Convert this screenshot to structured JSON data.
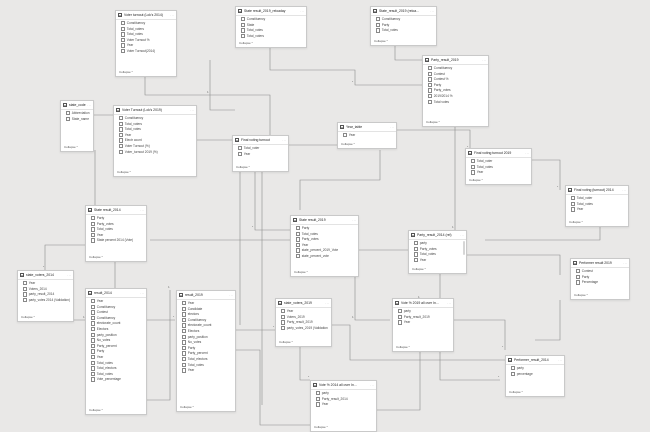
{
  "collapse_label": "Collapse ^",
  "tables": [
    {
      "id": "voter_turnout_2014",
      "title": "Voter turnout (Lok's 2014)",
      "fields": [
        "Constituency",
        "Total_voters",
        "Total_votes",
        "Voter Turnout %",
        "Year",
        "Voter Turnout(2014)"
      ]
    },
    {
      "id": "state_result_2019_reload",
      "title": "State result_2019_reloaday",
      "fields": [
        "Constituency",
        "State",
        "Total_votes",
        "Total_voters"
      ]
    },
    {
      "id": "state_result_2019_reload2",
      "title": "State_result_2019 (reloa...",
      "fields": [
        "Constituency",
        "Party",
        "Total_votes"
      ]
    },
    {
      "id": "party_result_2019",
      "title": "Party_result_2019",
      "fields": [
        "Constituency",
        "Contest",
        "Contest %",
        "Party",
        "Party_votes",
        "2019/2014 %",
        "Total votes"
      ]
    },
    {
      "id": "state_code",
      "title": "state_code",
      "fields": [
        "Abbreviation",
        "State_name"
      ]
    },
    {
      "id": "voter_turnout_2019",
      "title": "Voter Turnout (Lok's 2019)",
      "fields": [
        "Constituency",
        "Total_voters",
        "Total_votes",
        "Year",
        "Electr count",
        "Voter Turnout (%)",
        "Voter_turnout 2019 (%)"
      ]
    },
    {
      "id": "final_voting_turnout",
      "title": "Final voting turnout",
      "fields": [
        "Total_voter",
        "Year"
      ]
    },
    {
      "id": "year_table",
      "title": "Year_table",
      "fields": [
        "Year"
      ]
    },
    {
      "id": "final_voting_turnout_2019",
      "title": "Final voting turnout 2019",
      "fields": [
        "Total_voter",
        "Total_votes",
        "Year"
      ]
    },
    {
      "id": "final_voting_turnout_2014",
      "title": "Final voting (turnout) 2014",
      "fields": [
        "Total_voter",
        "Total_votes",
        "Year"
      ]
    },
    {
      "id": "state_result_2014",
      "title": "State result_2014",
      "fields": [
        "Party",
        "Party_votes",
        "Total_votes",
        "Year",
        "State percent 2014 (Vote)"
      ]
    },
    {
      "id": "state_result_2019",
      "title": "State result_2019",
      "fields": [
        "Party",
        "Total_votes",
        "Party_votes",
        "Year",
        "state_percent_2019_Vote",
        "state_percent_vote"
      ]
    },
    {
      "id": "party_result_2014",
      "title": "Party_result_2014 (rel)",
      "fields": [
        "party",
        "Party_votes",
        "Total_votes",
        "Year",
        "party_share"
      ]
    },
    {
      "id": "performer_result_2019",
      "title": "Performer result 2019",
      "fields": [
        "Contest",
        "Party",
        "Percentage"
      ]
    },
    {
      "id": "state_voters_2014",
      "title": "state_voters_2014",
      "fields": [
        "Year",
        "Voters_2014",
        "party_result_2014",
        "party_votes 2014 (Validation)"
      ]
    },
    {
      "id": "result_2014",
      "title": "result_2014",
      "fields": [
        "Year",
        "Constituency",
        "Contest",
        "Constituency",
        "electorate_count",
        "Electors",
        "party_position",
        "No_votes",
        "Party_percent",
        "Party",
        "Year",
        "Total_votes",
        "Total_electors",
        "Total_votes",
        "Vote_percentage"
      ]
    },
    {
      "id": "result_2019",
      "title": "result_2019",
      "fields": [
        "Year",
        "Candidate",
        "electors",
        "Constituency",
        "electorate_count",
        "Electors",
        "party_position",
        "No_votes",
        "Party",
        "Party_percent",
        "Total_electors",
        "Total_votes",
        "Year"
      ]
    },
    {
      "id": "state_voters_2019",
      "title": "state_voters_2019",
      "fields": [
        "Year",
        "Voters_2019",
        "Party_result_2019",
        "party_votes_2019 (Validation)"
      ]
    },
    {
      "id": "vote_pct_2019_all",
      "title": "Vote % 2019 all over In...",
      "fields": [
        "party",
        "Party_result_2019",
        "Year"
      ]
    },
    {
      "id": "performer_result_2014",
      "title": "Performer_result_2014",
      "fields": [
        "party",
        "percentage"
      ]
    },
    {
      "id": "vote_pct_2014_all",
      "title": "Vote % 2014 all over In...",
      "fields": [
        "party",
        "Party_result_2014",
        "Year"
      ]
    }
  ],
  "rel_labels": [
    "1",
    "*",
    "1",
    "*",
    "*",
    "1",
    "*",
    "1",
    "1",
    "*",
    "1",
    "*",
    "*",
    "1",
    "*",
    "1",
    "*",
    "1",
    "1",
    "*"
  ]
}
